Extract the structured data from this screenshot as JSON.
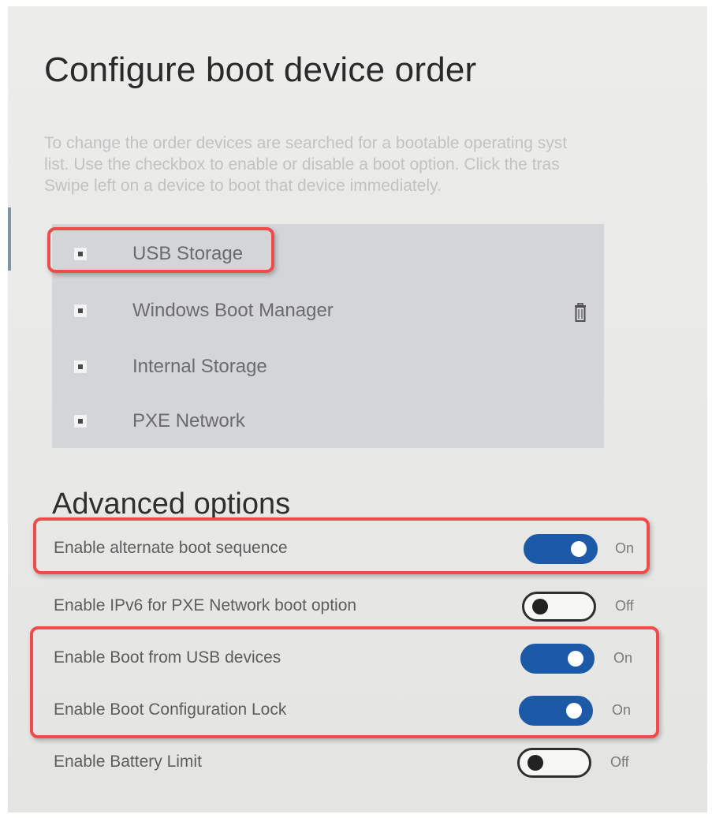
{
  "page": {
    "title": "Configure boot device order",
    "description_lines": [
      "To change the order devices are searched for a bootable operating syst",
      "list.  Use the checkbox to enable or disable a boot option.  Click the tras",
      "Swipe left on a device to boot that device immediately."
    ]
  },
  "boot_devices": [
    {
      "label": "USB Storage",
      "checked": true
    },
    {
      "label": "Windows Boot Manager",
      "checked": true
    },
    {
      "label": "Internal Storage",
      "checked": true
    },
    {
      "label": "PXE Network",
      "checked": true
    }
  ],
  "icons": {
    "delete": "trash-icon"
  },
  "advanced": {
    "title": "Advanced options",
    "options": [
      {
        "label": "Enable alternate boot sequence",
        "state": "On",
        "on": true
      },
      {
        "label": "Enable IPv6 for PXE Network boot option",
        "state": "Off",
        "on": false
      },
      {
        "label": "Enable Boot from USB devices",
        "state": "On",
        "on": true
      },
      {
        "label": "Enable Boot Configuration Lock",
        "state": "On",
        "on": true
      },
      {
        "label": "Enable Battery Limit",
        "state": "Off",
        "on": false
      }
    ]
  },
  "colors": {
    "toggle_on": "#1c5aa8",
    "highlight": "#ef4b4b",
    "list_background": "#d4d5d7"
  }
}
